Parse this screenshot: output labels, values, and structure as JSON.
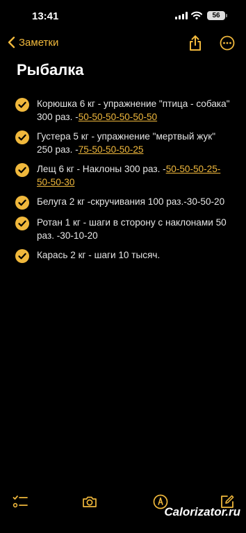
{
  "status_bar": {
    "time": "13:41",
    "battery": "56"
  },
  "nav": {
    "back_label": "Заметки"
  },
  "note": {
    "title": "Рыбалка",
    "items": [
      {
        "text": "Корюшка 6 кг - упражнение \"птица - собака\"  300 раз.  -",
        "link": "50-50-50-50-50-50",
        "checked": true
      },
      {
        "text": "Густера 5 кг - упражнение \"мертвый жук\"  250 раз. -",
        "link": "75-50-50-50-25",
        "checked": true
      },
      {
        "text": "Лещ 6 кг - Наклоны 300 раз. -",
        "link": "50-50-50-25-50-50-30",
        "checked": true
      },
      {
        "text": "Белуга 2 кг -скручивания 100 раз.-30-50-20",
        "link": "",
        "checked": true
      },
      {
        "text": "Ротан 1 кг - шаги в сторону с наклонами 50 раз. -30-10-20",
        "link": "",
        "checked": true
      },
      {
        "text": "Карась 2 кг - шаги 10 тысяч.",
        "link": "",
        "checked": true
      }
    ]
  },
  "watermark": "Calorizator.ru",
  "colors": {
    "accent": "#f0b83c",
    "background": "#000000",
    "text": "#e6e6e6"
  }
}
